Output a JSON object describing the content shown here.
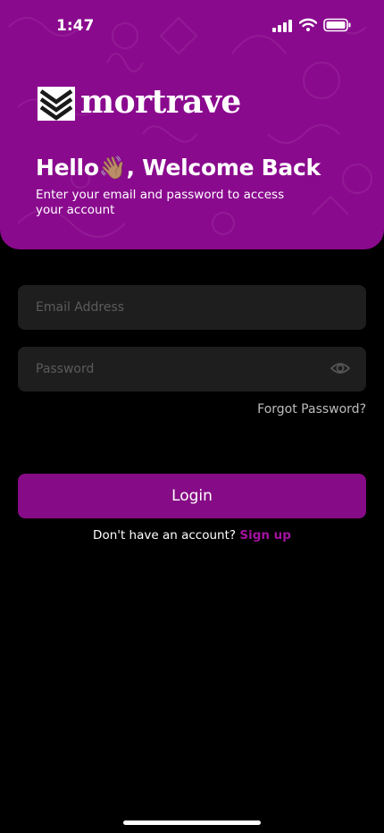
{
  "status_bar": {
    "time": "1:47",
    "icons": [
      "signal-icon",
      "wifi-icon",
      "battery-icon"
    ]
  },
  "brand": {
    "name": "mortrave",
    "logo_icon": "chevron-logo-icon"
  },
  "header": {
    "title": "Hello👋🏽, Welcome Back",
    "subtitle": "Enter your email and password to access your account"
  },
  "form": {
    "email_placeholder": "Email Address",
    "email_value": "",
    "password_placeholder": "Password",
    "password_value": "",
    "password_toggle_icon": "eye-icon",
    "forgot_label": "Forgot Password?",
    "login_label": "Login"
  },
  "signup": {
    "prompt": "Don't have an account?",
    "link": "Sign up"
  },
  "colors": {
    "brand": "#8a0a8e",
    "button": "#860b86",
    "link": "#a3129f",
    "field": "#1e1e1e",
    "background": "#000000"
  }
}
